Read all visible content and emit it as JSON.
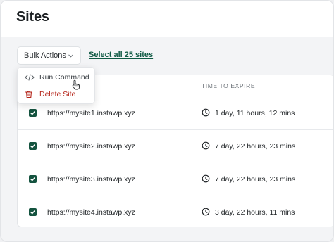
{
  "header": {
    "title": "Sites"
  },
  "toolbar": {
    "bulk_actions_label": "Bulk Actions",
    "select_all_label": "Select all 25 sites"
  },
  "dropdown": {
    "items": [
      {
        "label": "Run Command",
        "icon": "code-icon"
      },
      {
        "label": "Delete Site",
        "icon": "trash-icon"
      }
    ]
  },
  "table": {
    "columns": {
      "expire": "TIME TO EXPIRE"
    },
    "rows": [
      {
        "url": "https://mysite1.instawp.xyz",
        "expire": "1 day, 11 hours, 12 mins",
        "checked": true
      },
      {
        "url": "https://mysite2.instawp.xyz",
        "expire": "7 day, 22 hours, 23 mins",
        "checked": true
      },
      {
        "url": "https://mysite3.instawp.xyz",
        "expire": "7 day, 22 hours, 23 mins",
        "checked": true
      },
      {
        "url": "https://mysite4.instawp.xyz",
        "expire": "3 day, 22 hours, 11 mins",
        "checked": true
      }
    ]
  },
  "colors": {
    "accent": "#14533f",
    "danger": "#b42318",
    "link": "#0f5a44"
  }
}
